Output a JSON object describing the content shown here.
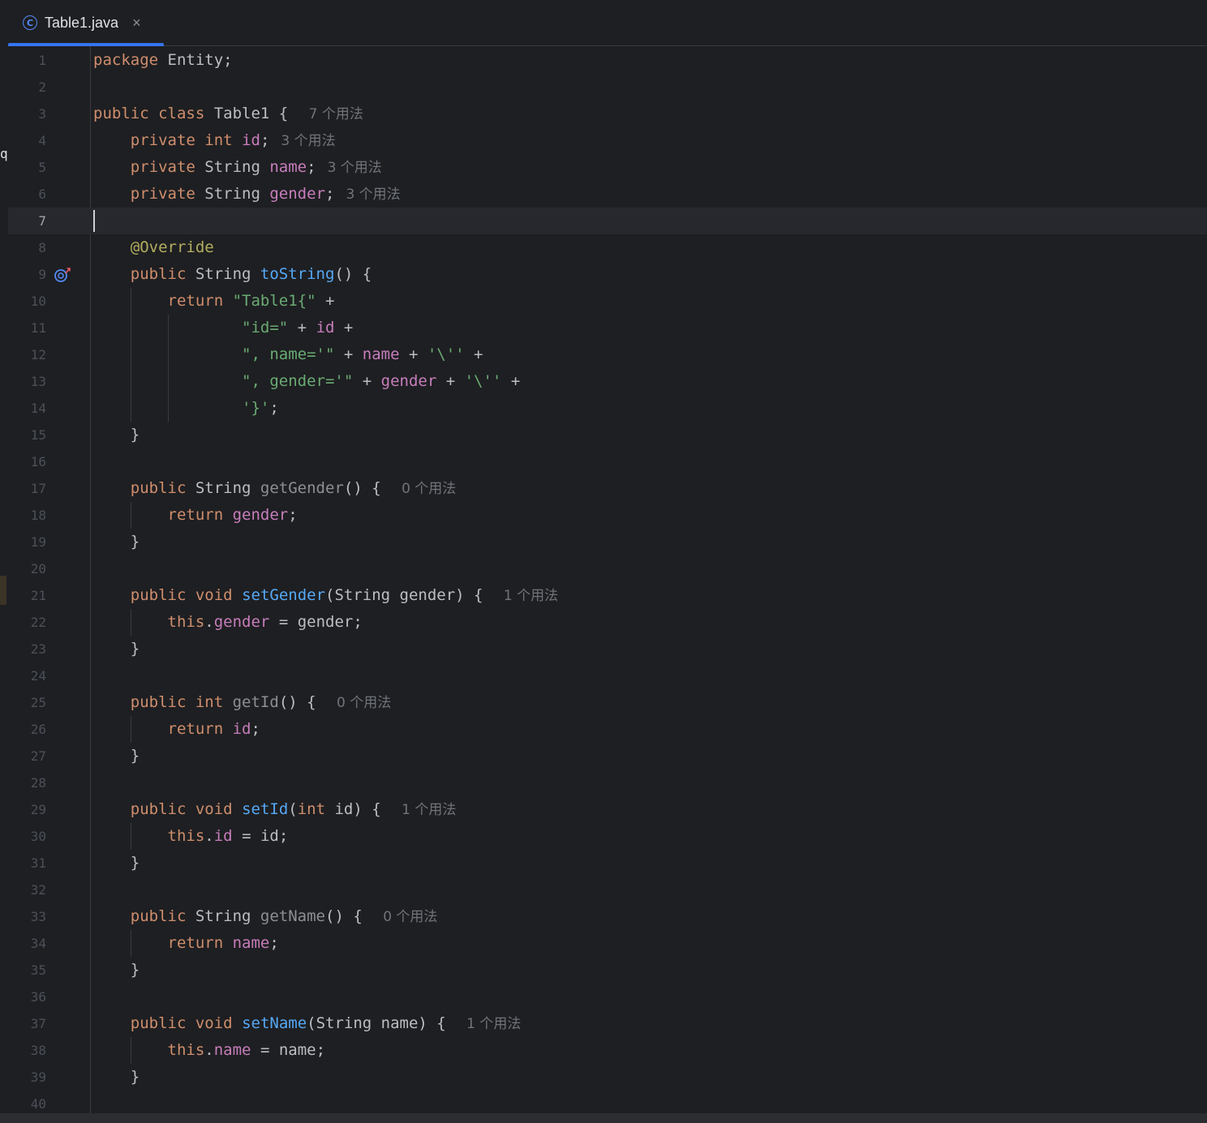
{
  "tab": {
    "icon": "class-c-icon",
    "filename": "Table1.java",
    "close_glyph": "×"
  },
  "left_edge_char": "q",
  "editor": {
    "current_line": 7,
    "lines": [
      {
        "n": "1",
        "tokens": [
          [
            "kw",
            "package"
          ],
          [
            "p",
            " Entity;"
          ]
        ]
      },
      {
        "n": "2",
        "tokens": []
      },
      {
        "n": "3",
        "tokens": [
          [
            "kw",
            "public class"
          ],
          [
            "p",
            " Table1 { "
          ]
        ],
        "hint": "7 个用法"
      },
      {
        "n": "4",
        "tokens": [
          [
            "p",
            "    "
          ],
          [
            "kw",
            "private int"
          ],
          [
            "p",
            " "
          ],
          [
            "fld",
            "id"
          ],
          [
            "p",
            ";"
          ]
        ],
        "hint": "3 个用法"
      },
      {
        "n": "5",
        "tokens": [
          [
            "p",
            "    "
          ],
          [
            "kw",
            "private"
          ],
          [
            "p",
            " String "
          ],
          [
            "fld",
            "name"
          ],
          [
            "p",
            ";"
          ]
        ],
        "hint": "3 个用法"
      },
      {
        "n": "6",
        "tokens": [
          [
            "p",
            "    "
          ],
          [
            "kw",
            "private"
          ],
          [
            "p",
            " String "
          ],
          [
            "fld",
            "gender"
          ],
          [
            "p",
            ";"
          ]
        ],
        "hint": "3 个用法"
      },
      {
        "n": "7",
        "tokens": []
      },
      {
        "n": "8",
        "tokens": [
          [
            "p",
            "    "
          ],
          [
            "ann",
            "@Override"
          ]
        ]
      },
      {
        "n": "9",
        "tokens": [
          [
            "p",
            "    "
          ],
          [
            "kw",
            "public"
          ],
          [
            "p",
            " String "
          ],
          [
            "fn",
            "toString"
          ],
          [
            "p",
            "() {"
          ]
        ],
        "gutter_icon": "override-up-icon"
      },
      {
        "n": "10",
        "tokens": [
          [
            "p",
            "        "
          ],
          [
            "kw",
            "return"
          ],
          [
            "p",
            " "
          ],
          [
            "str",
            "\"Table1{\""
          ],
          [
            "p",
            " +"
          ]
        ]
      },
      {
        "n": "11",
        "tokens": [
          [
            "p",
            "                "
          ],
          [
            "str",
            "\"id=\""
          ],
          [
            "p",
            " + "
          ],
          [
            "fld",
            "id"
          ],
          [
            "p",
            " +"
          ]
        ]
      },
      {
        "n": "12",
        "tokens": [
          [
            "p",
            "                "
          ],
          [
            "str",
            "\", name='\""
          ],
          [
            "p",
            " + "
          ],
          [
            "fld",
            "name"
          ],
          [
            "p",
            " + "
          ],
          [
            "str",
            "'\\''"
          ],
          [
            "p",
            " +"
          ]
        ]
      },
      {
        "n": "13",
        "tokens": [
          [
            "p",
            "                "
          ],
          [
            "str",
            "\", gender='\""
          ],
          [
            "p",
            " + "
          ],
          [
            "fld",
            "gender"
          ],
          [
            "p",
            " + "
          ],
          [
            "str",
            "'\\''"
          ],
          [
            "p",
            " +"
          ]
        ]
      },
      {
        "n": "14",
        "tokens": [
          [
            "p",
            "                "
          ],
          [
            "str",
            "'}'"
          ],
          [
            "p",
            ";"
          ]
        ]
      },
      {
        "n": "15",
        "tokens": [
          [
            "p",
            "    }"
          ]
        ]
      },
      {
        "n": "16",
        "tokens": []
      },
      {
        "n": "17",
        "tokens": [
          [
            "p",
            "    "
          ],
          [
            "kw",
            "public"
          ],
          [
            "p",
            " String "
          ],
          [
            "unused",
            "getGender"
          ],
          [
            "p",
            "() { "
          ]
        ],
        "hint": "0 个用法"
      },
      {
        "n": "18",
        "tokens": [
          [
            "p",
            "        "
          ],
          [
            "kw",
            "return"
          ],
          [
            "p",
            " "
          ],
          [
            "fld",
            "gender"
          ],
          [
            "p",
            ";"
          ]
        ]
      },
      {
        "n": "19",
        "tokens": [
          [
            "p",
            "    }"
          ]
        ]
      },
      {
        "n": "20",
        "tokens": []
      },
      {
        "n": "21",
        "tokens": [
          [
            "p",
            "    "
          ],
          [
            "kw",
            "public void"
          ],
          [
            "p",
            " "
          ],
          [
            "fn",
            "setGender"
          ],
          [
            "p",
            "(String gender) { "
          ]
        ],
        "hint": "1 个用法"
      },
      {
        "n": "22",
        "tokens": [
          [
            "p",
            "        "
          ],
          [
            "kw",
            "this"
          ],
          [
            "p",
            "."
          ],
          [
            "fld",
            "gender"
          ],
          [
            "p",
            " = gender;"
          ]
        ]
      },
      {
        "n": "23",
        "tokens": [
          [
            "p",
            "    }"
          ]
        ]
      },
      {
        "n": "24",
        "tokens": []
      },
      {
        "n": "25",
        "tokens": [
          [
            "p",
            "    "
          ],
          [
            "kw",
            "public int"
          ],
          [
            "p",
            " "
          ],
          [
            "unused",
            "getId"
          ],
          [
            "p",
            "() { "
          ]
        ],
        "hint": "0 个用法"
      },
      {
        "n": "26",
        "tokens": [
          [
            "p",
            "        "
          ],
          [
            "kw",
            "return"
          ],
          [
            "p",
            " "
          ],
          [
            "fld",
            "id"
          ],
          [
            "p",
            ";"
          ]
        ]
      },
      {
        "n": "27",
        "tokens": [
          [
            "p",
            "    }"
          ]
        ]
      },
      {
        "n": "28",
        "tokens": []
      },
      {
        "n": "29",
        "tokens": [
          [
            "p",
            "    "
          ],
          [
            "kw",
            "public void"
          ],
          [
            "p",
            " "
          ],
          [
            "fn",
            "setId"
          ],
          [
            "p",
            "("
          ],
          [
            "kw",
            "int"
          ],
          [
            "p",
            " id) { "
          ]
        ],
        "hint": "1 个用法"
      },
      {
        "n": "30",
        "tokens": [
          [
            "p",
            "        "
          ],
          [
            "kw",
            "this"
          ],
          [
            "p",
            "."
          ],
          [
            "fld",
            "id"
          ],
          [
            "p",
            " = id;"
          ]
        ]
      },
      {
        "n": "31",
        "tokens": [
          [
            "p",
            "    }"
          ]
        ]
      },
      {
        "n": "32",
        "tokens": []
      },
      {
        "n": "33",
        "tokens": [
          [
            "p",
            "    "
          ],
          [
            "kw",
            "public"
          ],
          [
            "p",
            " String "
          ],
          [
            "unused",
            "getName"
          ],
          [
            "p",
            "() { "
          ]
        ],
        "hint": "0 个用法"
      },
      {
        "n": "34",
        "tokens": [
          [
            "p",
            "        "
          ],
          [
            "kw",
            "return"
          ],
          [
            "p",
            " "
          ],
          [
            "fld",
            "name"
          ],
          [
            "p",
            ";"
          ]
        ]
      },
      {
        "n": "35",
        "tokens": [
          [
            "p",
            "    }"
          ]
        ]
      },
      {
        "n": "36",
        "tokens": []
      },
      {
        "n": "37",
        "tokens": [
          [
            "p",
            "    "
          ],
          [
            "kw",
            "public void"
          ],
          [
            "p",
            " "
          ],
          [
            "fn",
            "setName"
          ],
          [
            "p",
            "(String name) { "
          ]
        ],
        "hint": "1 个用法"
      },
      {
        "n": "38",
        "tokens": [
          [
            "p",
            "        "
          ],
          [
            "kw",
            "this"
          ],
          [
            "p",
            "."
          ],
          [
            "fld",
            "name"
          ],
          [
            "p",
            " = name;"
          ]
        ]
      },
      {
        "n": "39",
        "tokens": [
          [
            "p",
            "    }"
          ]
        ]
      },
      {
        "n": "40",
        "tokens": []
      }
    ]
  },
  "colors": {
    "background": "#1e1f22",
    "keyword": "#cf8e6d",
    "field": "#c77dbb",
    "string": "#6aab73",
    "annotation": "#b3ae60",
    "method": "#56a8f5",
    "accent": "#3574f0"
  }
}
